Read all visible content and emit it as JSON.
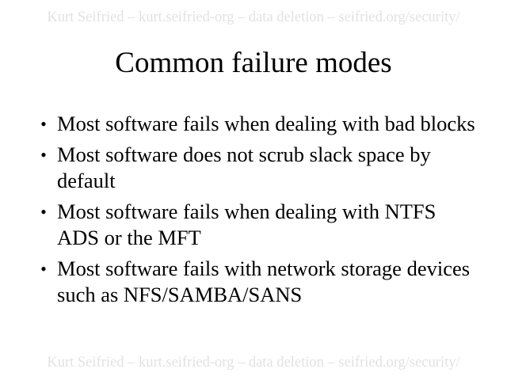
{
  "header": {
    "text": "Kurt Seifried – kurt.seifried-org – data deletion – seifried.org/security/"
  },
  "title": "Common failure modes",
  "bullets": [
    {
      "text": "Most software fails when dealing with bad blocks"
    },
    {
      "text": "Most software does not scrub slack space by default"
    },
    {
      "text": "Most software fails when dealing with NTFS ADS or the MFT"
    },
    {
      "text": "Most software fails with network storage devices such as NFS/SAMBA/SANS"
    }
  ],
  "footer": {
    "text": "Kurt Seifried – kurt.seifried-org – data deletion – seifried.org/security/"
  },
  "bullet_symbol": "•",
  "colors": {
    "background": "#ffffff",
    "text": "#000000",
    "header_footer": "#e2e2e2"
  }
}
